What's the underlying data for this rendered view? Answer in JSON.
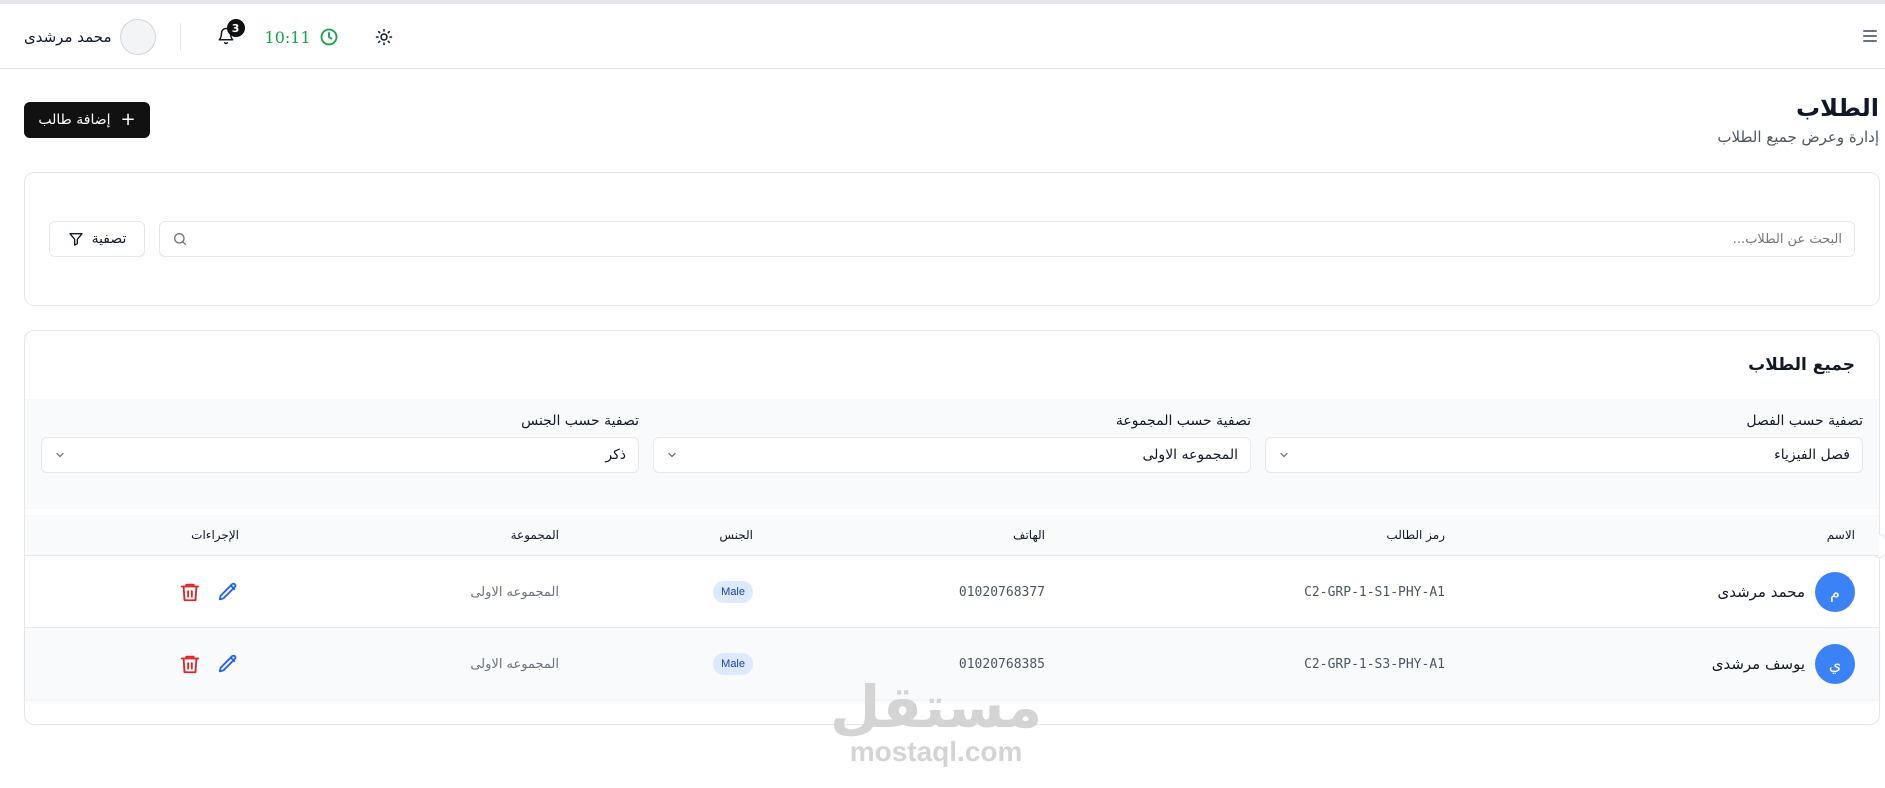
{
  "header": {
    "user_name": "محمد مرشدى",
    "notification_count": "3",
    "time": "10:11"
  },
  "page": {
    "title": "الطلاب",
    "subtitle": "إدارة وعرض جميع الطلاب",
    "add_button_label": "إضافة طالب"
  },
  "search": {
    "placeholder": "البحث عن الطلاب...",
    "filter_button_label": "تصفية"
  },
  "table_card": {
    "title": "جميع الطلاب",
    "filters": {
      "class_label": "تصفية حسب الفصل",
      "class_value": "فصل الفيزياء",
      "group_label": "تصفية حسب المجموعة",
      "group_value": "المجموعه الاولى",
      "gender_label": "تصفية حسب الجنس",
      "gender_value": "ذكر"
    },
    "columns": {
      "name": "الاسم",
      "code": "رمز الطالب",
      "phone": "الهاتف",
      "gender": "الجنس",
      "group": "المجموعة",
      "actions": "الإجراءات"
    },
    "rows": [
      {
        "initial": "م",
        "name": "محمد مرشدى",
        "code": "C2-GRP-1-S1-PHY-A1",
        "phone": "01020768377",
        "gender": "Male",
        "group": "المجموعه الاولى"
      },
      {
        "initial": "ي",
        "name": "يوسف مرشدى",
        "code": "C2-GRP-1-S3-PHY-A1",
        "phone": "01020768385",
        "gender": "Male",
        "group": "المجموعه الاولى"
      }
    ]
  },
  "watermark": {
    "arabic": "مستقل",
    "latin": "mostaql.com"
  },
  "colors": {
    "accent_green": "#16a34a",
    "avatar_blue": "#3b82f6",
    "edit_blue": "#2563eb",
    "delete_red": "#dc2626"
  }
}
